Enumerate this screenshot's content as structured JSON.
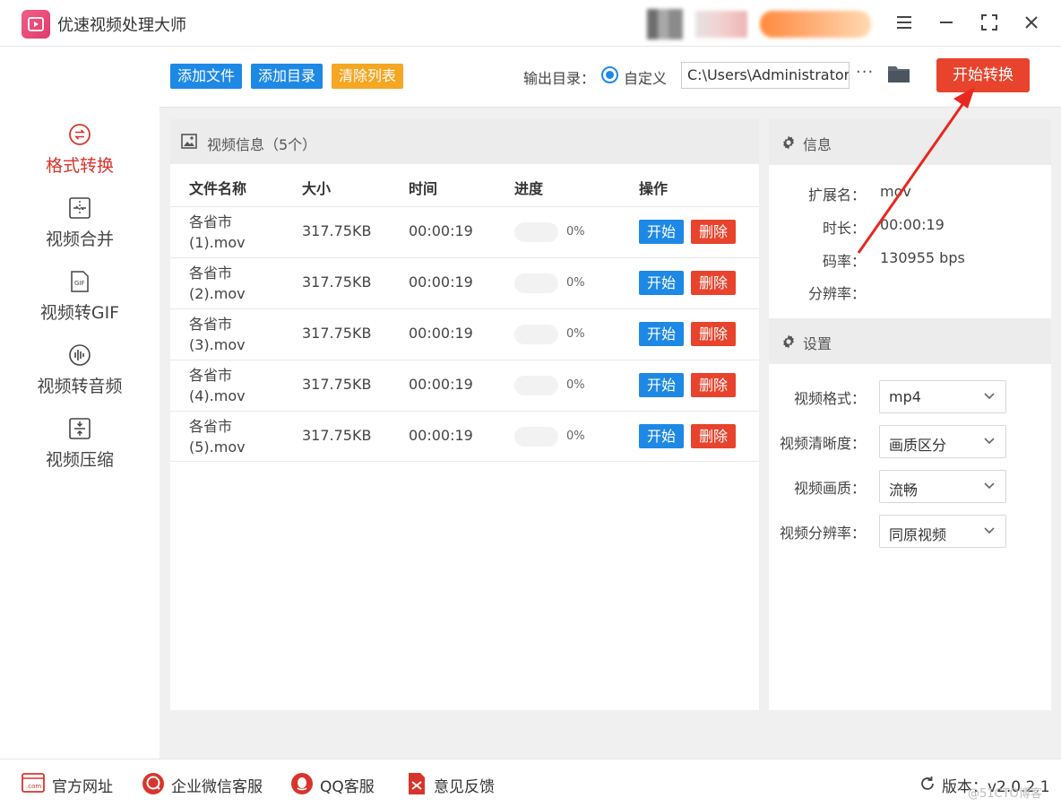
{
  "app": {
    "title": "优速视频处理大师"
  },
  "sidebar": {
    "items": [
      {
        "label": "格式转换",
        "icon": "format-convert-icon",
        "active": true
      },
      {
        "label": "视频合并",
        "icon": "merge-icon",
        "active": false
      },
      {
        "label": "视频转GIF",
        "icon": "gif-icon",
        "active": false
      },
      {
        "label": "视频转音频",
        "icon": "audio-icon",
        "active": false
      },
      {
        "label": "视频压缩",
        "icon": "compress-icon",
        "active": false
      }
    ]
  },
  "toolbar": {
    "add_file": "添加文件",
    "add_dir": "添加目录",
    "clear_list": "清除列表",
    "output_label": "输出目录：",
    "custom_label": "自定义",
    "output_path": "C:\\Users\\Administrator\\",
    "more": "···",
    "start_convert": "开始转换"
  },
  "list": {
    "title": "视频信息（5个）",
    "columns": {
      "name": "文件名称",
      "size": "大小",
      "time": "时间",
      "progress": "进度",
      "action": "操作"
    },
    "rows": [
      {
        "name": "各省市 (1).mov",
        "size": "317.75KB",
        "time": "00:00:19",
        "progress_text": "0%",
        "progress": 0,
        "start": "开始",
        "delete": "删除"
      },
      {
        "name": "各省市 (2).mov",
        "size": "317.75KB",
        "time": "00:00:19",
        "progress_text": "0%",
        "progress": 0,
        "start": "开始",
        "delete": "删除"
      },
      {
        "name": "各省市 (3).mov",
        "size": "317.75KB",
        "time": "00:00:19",
        "progress_text": "0%",
        "progress": 0,
        "start": "开始",
        "delete": "删除"
      },
      {
        "name": "各省市 (4).mov",
        "size": "317.75KB",
        "time": "00:00:19",
        "progress_text": "0%",
        "progress": 0,
        "start": "开始",
        "delete": "删除"
      },
      {
        "name": "各省市 (5).mov",
        "size": "317.75KB",
        "time": "00:00:19",
        "progress_text": "0%",
        "progress": 0,
        "start": "开始",
        "delete": "删除"
      }
    ]
  },
  "info": {
    "title": "信息",
    "ext_label": "扩展名：",
    "ext_value": "mov",
    "duration_label": "时长：",
    "duration_value": "00:00:19",
    "bitrate_label": "码率：",
    "bitrate_value": "130955 bps",
    "resolution_label": "分辨率：",
    "resolution_value": ""
  },
  "settings": {
    "title": "设置",
    "format_label": "视频格式：",
    "format_value": "mp4",
    "clarity_label": "视频清晰度：",
    "clarity_value": "画质区分",
    "quality_label": "视频画质：",
    "quality_value": "流畅",
    "resolution_label": "视频分辨率：",
    "resolution_value": "同原视频"
  },
  "footer": {
    "website": "官方网址",
    "wechat": "企业微信客服",
    "qq": "QQ客服",
    "feedback": "意见反馈",
    "version": "版本：v2.0.2.1"
  },
  "watermark": "@51CTO博客",
  "colors": {
    "primary_blue": "#1e88e5",
    "danger_red": "#e8432c",
    "warning_orange": "#f5a623",
    "active_red": "#d9342b"
  }
}
